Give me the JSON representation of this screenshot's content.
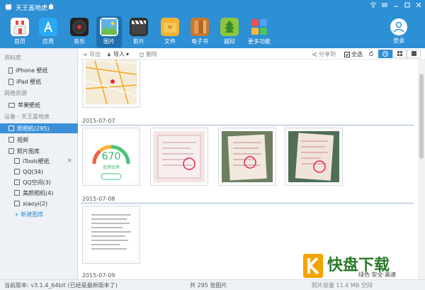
{
  "titlebar": {
    "title": "天王盖地虎"
  },
  "toolbar": {
    "items": [
      {
        "label": "首页",
        "icon": "store-icon"
      },
      {
        "label": "应用",
        "icon": "app-store-icon"
      },
      {
        "label": "音乐",
        "icon": "music-icon"
      },
      {
        "label": "图片",
        "icon": "image-icon"
      },
      {
        "label": "影片",
        "icon": "film-icon"
      },
      {
        "label": "文件",
        "icon": "folder-icon"
      },
      {
        "label": "电子书",
        "icon": "book-icon"
      },
      {
        "label": "越狱",
        "icon": "jailbreak-icon"
      },
      {
        "label": "更多功能",
        "icon": "more-apps-icon"
      }
    ],
    "login_label": "登录"
  },
  "sidebar": {
    "section_library": "资料库",
    "iphone_wallpaper": "iPhone 壁纸",
    "ipad_wallpaper": "iPad 壁纸",
    "section_network": "网络资源",
    "apple_wallpaper": "苹果壁纸",
    "section_device": "设备 - 天王盖地虎",
    "camera_roll": "照相机(295)",
    "video": "视频",
    "photo_library": "照片图库",
    "itools_wallpaper": "iTools壁纸",
    "qq": "QQ(34)",
    "qq_space": "QQ空间(3)",
    "meiyan": "美颜相机(4)",
    "xiaoyi": "xiaoyi(2)",
    "new_library": "+ 新建图库"
  },
  "actionbar": {
    "export": "导出",
    "import": "导入",
    "delete": "删除",
    "share": "分享到",
    "select_all": "全选"
  },
  "content": {
    "dates": [
      "2015-07-07",
      "2015-07-08",
      "2015-07-09"
    ],
    "credit_score": "670",
    "credit_text": "信用优秀"
  },
  "statusbar": {
    "version": "当前版本: v3.1.4_64bit  (已经是最新版本了)",
    "count": "共 295 张图片",
    "storage": "照片容量 11.4 MB 空间"
  },
  "colors": {
    "accent": "#2d8fd4",
    "sidebar_bg": "#eef1f5",
    "selected": "#3a8fd8"
  },
  "watermark": {
    "brand": "快盘下载",
    "slogan": "绿色·安全·高速"
  }
}
